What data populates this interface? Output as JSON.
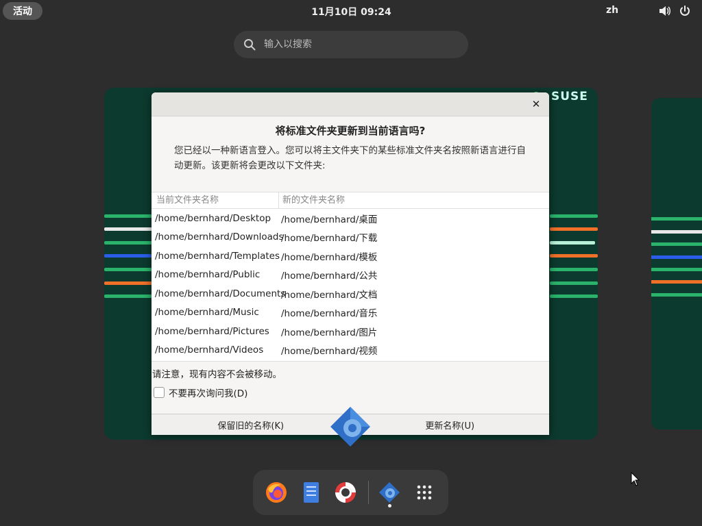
{
  "topbar": {
    "activities": "活动",
    "clock": "11月10日  09:24",
    "language": "zh",
    "volume_icon": "volume-icon",
    "power_icon": "power-icon"
  },
  "search": {
    "placeholder": "输入以搜索"
  },
  "workspace": {
    "brand": "SUSE"
  },
  "dialog": {
    "title": "将标准文件夹更新到当前语言吗?",
    "description": "您已经以一种新语言登入。您可以将主文件夹下的某些标准文件夹名按照新语言进行自动更新。该更新将会更改以下文件夹:",
    "columns": [
      "当前文件夹名称",
      "新的文件夹名称"
    ],
    "rows": [
      [
        "/home/bernhard/Desktop",
        "/home/bernhard/桌面"
      ],
      [
        "/home/bernhard/Downloads",
        "/home/bernhard/下载"
      ],
      [
        "/home/bernhard/Templates",
        "/home/bernhard/模板"
      ],
      [
        "/home/bernhard/Public",
        "/home/bernhard/公共"
      ],
      [
        "/home/bernhard/Documents",
        "/home/bernhard/文档"
      ],
      [
        "/home/bernhard/Music",
        "/home/bernhard/音乐"
      ],
      [
        "/home/bernhard/Pictures",
        "/home/bernhard/图片"
      ],
      [
        "/home/bernhard/Videos",
        "/home/bernhard/视频"
      ]
    ],
    "note": "请注意，现有内容不会被移动。",
    "dont_ask": "不要再次询问我(D)",
    "dont_ask_checked": false,
    "keep_button": "保留旧的名称(K)",
    "update_button": "更新名称(U)"
  },
  "dock": {
    "items": [
      "firefox-icon",
      "text-editor-icon",
      "help-icon",
      "settings-icon",
      "app-grid-icon"
    ]
  },
  "colors": {
    "workspace_bg": "#0c3a2e",
    "stripe_green": "#2ecc71",
    "stripe_orange": "#f0702a",
    "stripe_blue": "#2a5ee8"
  }
}
